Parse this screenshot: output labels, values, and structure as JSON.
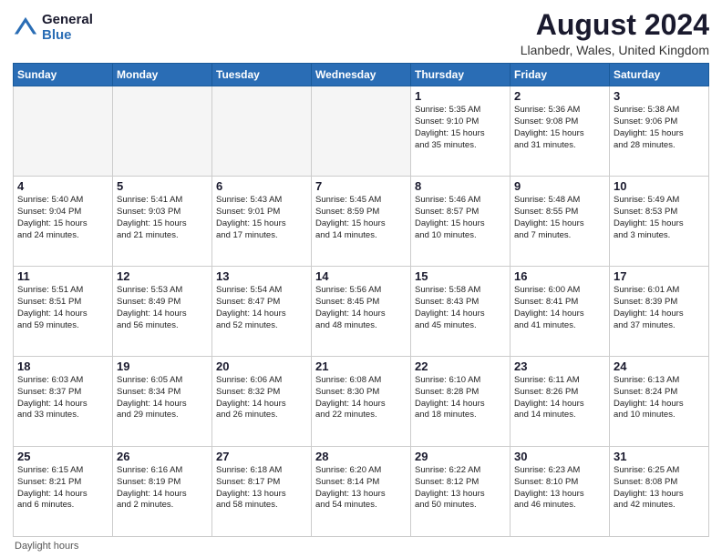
{
  "header": {
    "logo_general": "General",
    "logo_blue": "Blue",
    "main_title": "August 2024",
    "subtitle": "Llanbedr, Wales, United Kingdom"
  },
  "days_of_week": [
    "Sunday",
    "Monday",
    "Tuesday",
    "Wednesday",
    "Thursday",
    "Friday",
    "Saturday"
  ],
  "weeks": [
    [
      {
        "day": "",
        "info": ""
      },
      {
        "day": "",
        "info": ""
      },
      {
        "day": "",
        "info": ""
      },
      {
        "day": "",
        "info": ""
      },
      {
        "day": "1",
        "info": "Sunrise: 5:35 AM\nSunset: 9:10 PM\nDaylight: 15 hours\nand 35 minutes."
      },
      {
        "day": "2",
        "info": "Sunrise: 5:36 AM\nSunset: 9:08 PM\nDaylight: 15 hours\nand 31 minutes."
      },
      {
        "day": "3",
        "info": "Sunrise: 5:38 AM\nSunset: 9:06 PM\nDaylight: 15 hours\nand 28 minutes."
      }
    ],
    [
      {
        "day": "4",
        "info": "Sunrise: 5:40 AM\nSunset: 9:04 PM\nDaylight: 15 hours\nand 24 minutes."
      },
      {
        "day": "5",
        "info": "Sunrise: 5:41 AM\nSunset: 9:03 PM\nDaylight: 15 hours\nand 21 minutes."
      },
      {
        "day": "6",
        "info": "Sunrise: 5:43 AM\nSunset: 9:01 PM\nDaylight: 15 hours\nand 17 minutes."
      },
      {
        "day": "7",
        "info": "Sunrise: 5:45 AM\nSunset: 8:59 PM\nDaylight: 15 hours\nand 14 minutes."
      },
      {
        "day": "8",
        "info": "Sunrise: 5:46 AM\nSunset: 8:57 PM\nDaylight: 15 hours\nand 10 minutes."
      },
      {
        "day": "9",
        "info": "Sunrise: 5:48 AM\nSunset: 8:55 PM\nDaylight: 15 hours\nand 7 minutes."
      },
      {
        "day": "10",
        "info": "Sunrise: 5:49 AM\nSunset: 8:53 PM\nDaylight: 15 hours\nand 3 minutes."
      }
    ],
    [
      {
        "day": "11",
        "info": "Sunrise: 5:51 AM\nSunset: 8:51 PM\nDaylight: 14 hours\nand 59 minutes."
      },
      {
        "day": "12",
        "info": "Sunrise: 5:53 AM\nSunset: 8:49 PM\nDaylight: 14 hours\nand 56 minutes."
      },
      {
        "day": "13",
        "info": "Sunrise: 5:54 AM\nSunset: 8:47 PM\nDaylight: 14 hours\nand 52 minutes."
      },
      {
        "day": "14",
        "info": "Sunrise: 5:56 AM\nSunset: 8:45 PM\nDaylight: 14 hours\nand 48 minutes."
      },
      {
        "day": "15",
        "info": "Sunrise: 5:58 AM\nSunset: 8:43 PM\nDaylight: 14 hours\nand 45 minutes."
      },
      {
        "day": "16",
        "info": "Sunrise: 6:00 AM\nSunset: 8:41 PM\nDaylight: 14 hours\nand 41 minutes."
      },
      {
        "day": "17",
        "info": "Sunrise: 6:01 AM\nSunset: 8:39 PM\nDaylight: 14 hours\nand 37 minutes."
      }
    ],
    [
      {
        "day": "18",
        "info": "Sunrise: 6:03 AM\nSunset: 8:37 PM\nDaylight: 14 hours\nand 33 minutes."
      },
      {
        "day": "19",
        "info": "Sunrise: 6:05 AM\nSunset: 8:34 PM\nDaylight: 14 hours\nand 29 minutes."
      },
      {
        "day": "20",
        "info": "Sunrise: 6:06 AM\nSunset: 8:32 PM\nDaylight: 14 hours\nand 26 minutes."
      },
      {
        "day": "21",
        "info": "Sunrise: 6:08 AM\nSunset: 8:30 PM\nDaylight: 14 hours\nand 22 minutes."
      },
      {
        "day": "22",
        "info": "Sunrise: 6:10 AM\nSunset: 8:28 PM\nDaylight: 14 hours\nand 18 minutes."
      },
      {
        "day": "23",
        "info": "Sunrise: 6:11 AM\nSunset: 8:26 PM\nDaylight: 14 hours\nand 14 minutes."
      },
      {
        "day": "24",
        "info": "Sunrise: 6:13 AM\nSunset: 8:24 PM\nDaylight: 14 hours\nand 10 minutes."
      }
    ],
    [
      {
        "day": "25",
        "info": "Sunrise: 6:15 AM\nSunset: 8:21 PM\nDaylight: 14 hours\nand 6 minutes."
      },
      {
        "day": "26",
        "info": "Sunrise: 6:16 AM\nSunset: 8:19 PM\nDaylight: 14 hours\nand 2 minutes."
      },
      {
        "day": "27",
        "info": "Sunrise: 6:18 AM\nSunset: 8:17 PM\nDaylight: 13 hours\nand 58 minutes."
      },
      {
        "day": "28",
        "info": "Sunrise: 6:20 AM\nSunset: 8:14 PM\nDaylight: 13 hours\nand 54 minutes."
      },
      {
        "day": "29",
        "info": "Sunrise: 6:22 AM\nSunset: 8:12 PM\nDaylight: 13 hours\nand 50 minutes."
      },
      {
        "day": "30",
        "info": "Sunrise: 6:23 AM\nSunset: 8:10 PM\nDaylight: 13 hours\nand 46 minutes."
      },
      {
        "day": "31",
        "info": "Sunrise: 6:25 AM\nSunset: 8:08 PM\nDaylight: 13 hours\nand 42 minutes."
      }
    ]
  ],
  "footer": {
    "note": "Daylight hours"
  }
}
